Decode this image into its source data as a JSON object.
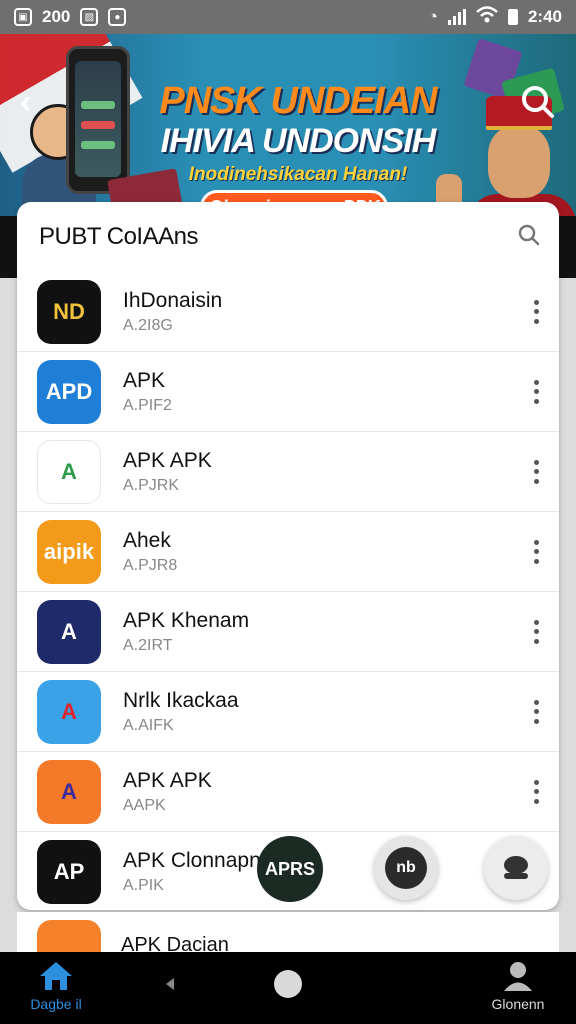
{
  "status_bar": {
    "left_time": "200",
    "right_time": "2:40"
  },
  "banner": {
    "line1": "PNSK UNDEIAN",
    "line2": "IHIVIA UNDONSIH",
    "line3": "Inodinehsikacan Hanan!",
    "pill": "Ohanaimo aam PPK"
  },
  "card": {
    "title": "PUBT CoIAAns"
  },
  "apps": [
    {
      "name": "IhDonaisin",
      "sub": "A.2I8G",
      "icon_text": "ND",
      "icon_color": "#111111",
      "icon_fg": "#f2c23a"
    },
    {
      "name": "APK",
      "sub": "A.PIF2",
      "icon_text": "APD",
      "icon_color": "#1f7fd6",
      "icon_fg": "#ffffff"
    },
    {
      "name": "APK APK",
      "sub": "A.PJRK",
      "icon_text": "A",
      "icon_color": "#ffffff",
      "icon_fg": "#2e9c4a"
    },
    {
      "name": "Ahek",
      "sub": "A.PJR8",
      "icon_text": "aipik",
      "icon_color": "#f39a1b",
      "icon_fg": "#ffffff"
    },
    {
      "name": "APK Khenam",
      "sub": "A.2IRT",
      "icon_text": "A",
      "icon_color": "#1f2a6b",
      "icon_fg": "#ffffff"
    },
    {
      "name": "Nrlk Ikackaa",
      "sub": "A.AIFK",
      "icon_text": "A",
      "icon_color": "#3aa2e6",
      "icon_fg": "#e3242b"
    },
    {
      "name": "APK APK",
      "sub": "AAPK",
      "icon_text": "A",
      "icon_color": "#f47a2a",
      "icon_fg": "#3b2a9e"
    },
    {
      "name": "APK Clonnapn",
      "sub": "A.PIK",
      "icon_text": "AP",
      "icon_color": "#111111",
      "icon_fg": "#ffffff"
    }
  ],
  "partial_app": {
    "name": "APK Dacian"
  },
  "fabs": {
    "main_label": "APRS",
    "second_label": "nb"
  },
  "bottom_nav": {
    "home_label": "Dagbe il",
    "profile_label": "Glonenn"
  }
}
